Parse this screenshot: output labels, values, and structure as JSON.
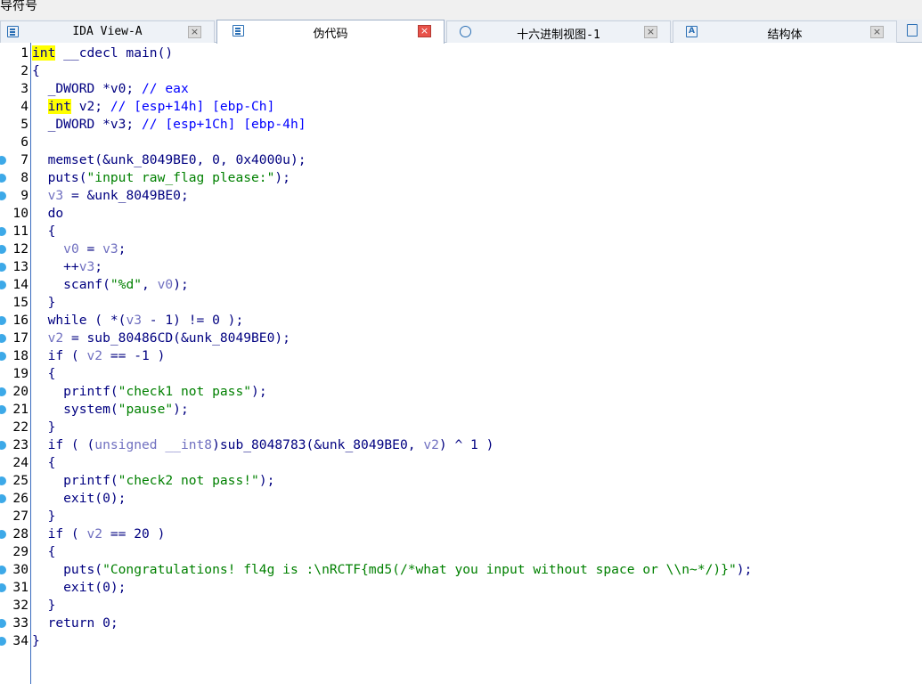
{
  "window": {
    "top_label": "导符号"
  },
  "tabs": [
    {
      "label": "IDA View-A",
      "icon": "ida-view-icon",
      "active": false
    },
    {
      "label": "伪代码",
      "icon": "pseudocode-icon",
      "active": true
    },
    {
      "label": "十六进制视图-1",
      "icon": "hex-view-icon",
      "active": false
    },
    {
      "label": "结构体",
      "icon": "structures-icon",
      "active": false
    }
  ],
  "close_glyph": "×",
  "colors": {
    "keyword_highlight": "#ffff00",
    "code": "#000080",
    "comment": "#0000ff",
    "string": "#008000",
    "variable": "#7070c0",
    "breakpoint": "#3da9e8"
  },
  "code_lines": [
    {
      "n": "1",
      "bp": false,
      "tokens": [
        [
          "int",
          "hl"
        ],
        [
          " __cdecl main()",
          "n"
        ]
      ]
    },
    {
      "n": "2",
      "bp": false,
      "tokens": [
        [
          "{",
          "n"
        ]
      ]
    },
    {
      "n": "3",
      "bp": false,
      "tokens": [
        [
          "  _DWORD *v0; ",
          "n"
        ],
        [
          "// eax",
          "c"
        ]
      ]
    },
    {
      "n": "4",
      "bp": false,
      "tokens": [
        [
          "  ",
          "n"
        ],
        [
          "int",
          "hl"
        ],
        [
          " v2; ",
          "n"
        ],
        [
          "// [esp+14h] [ebp-Ch]",
          "c"
        ]
      ]
    },
    {
      "n": "5",
      "bp": false,
      "tokens": [
        [
          "  _DWORD *v3; ",
          "n"
        ],
        [
          "// [esp+1Ch] [ebp-4h]",
          "c"
        ]
      ]
    },
    {
      "n": "6",
      "bp": false,
      "tokens": []
    },
    {
      "n": "7",
      "bp": true,
      "tokens": [
        [
          "  memset(&unk_8049BE0, 0, 0x4000u);",
          "n"
        ]
      ]
    },
    {
      "n": "8",
      "bp": true,
      "tokens": [
        [
          "  puts(",
          "n"
        ],
        [
          "\"input raw_flag please:\"",
          "s"
        ],
        [
          ");",
          "n"
        ]
      ]
    },
    {
      "n": "9",
      "bp": true,
      "tokens": [
        [
          "  ",
          "n"
        ],
        [
          "v3",
          "v"
        ],
        [
          " = &unk_8049BE0;",
          "n"
        ]
      ]
    },
    {
      "n": "10",
      "bp": false,
      "tokens": [
        [
          "  do",
          "n"
        ]
      ]
    },
    {
      "n": "11",
      "bp": true,
      "tokens": [
        [
          "  {",
          "n"
        ]
      ]
    },
    {
      "n": "12",
      "bp": true,
      "tokens": [
        [
          "    ",
          "n"
        ],
        [
          "v0",
          "v"
        ],
        [
          " = ",
          "n"
        ],
        [
          "v3",
          "v"
        ],
        [
          ";",
          "n"
        ]
      ]
    },
    {
      "n": "13",
      "bp": true,
      "tokens": [
        [
          "    ++",
          "n"
        ],
        [
          "v3",
          "v"
        ],
        [
          ";",
          "n"
        ]
      ]
    },
    {
      "n": "14",
      "bp": true,
      "tokens": [
        [
          "    scanf(",
          "n"
        ],
        [
          "\"%d\"",
          "s"
        ],
        [
          ", ",
          "n"
        ],
        [
          "v0",
          "v"
        ],
        [
          ");",
          "n"
        ]
      ]
    },
    {
      "n": "15",
      "bp": false,
      "tokens": [
        [
          "  }",
          "n"
        ]
      ]
    },
    {
      "n": "16",
      "bp": true,
      "tokens": [
        [
          "  while ( *(",
          "n"
        ],
        [
          "v3",
          "v"
        ],
        [
          " - 1) != 0 );",
          "n"
        ]
      ]
    },
    {
      "n": "17",
      "bp": true,
      "tokens": [
        [
          "  ",
          "n"
        ],
        [
          "v2",
          "v"
        ],
        [
          " = sub_80486CD(&unk_8049BE0);",
          "n"
        ]
      ]
    },
    {
      "n": "18",
      "bp": true,
      "tokens": [
        [
          "  if ( ",
          "n"
        ],
        [
          "v2",
          "v"
        ],
        [
          " == -1 )",
          "n"
        ]
      ]
    },
    {
      "n": "19",
      "bp": false,
      "tokens": [
        [
          "  {",
          "n"
        ]
      ]
    },
    {
      "n": "20",
      "bp": true,
      "tokens": [
        [
          "    printf(",
          "n"
        ],
        [
          "\"check1 not pass\"",
          "s"
        ],
        [
          ");",
          "n"
        ]
      ]
    },
    {
      "n": "21",
      "bp": true,
      "tokens": [
        [
          "    system(",
          "n"
        ],
        [
          "\"pause\"",
          "s"
        ],
        [
          ");",
          "n"
        ]
      ]
    },
    {
      "n": "22",
      "bp": false,
      "tokens": [
        [
          "  }",
          "n"
        ]
      ]
    },
    {
      "n": "23",
      "bp": true,
      "tokens": [
        [
          "  if ( (",
          "n"
        ],
        [
          "unsigned __int8",
          "v"
        ],
        [
          ")sub_8048783(&unk_8049BE0, ",
          "n"
        ],
        [
          "v2",
          "v"
        ],
        [
          ") ^ 1 )",
          "n"
        ]
      ]
    },
    {
      "n": "24",
      "bp": false,
      "tokens": [
        [
          "  {",
          "n"
        ]
      ]
    },
    {
      "n": "25",
      "bp": true,
      "tokens": [
        [
          "    printf(",
          "n"
        ],
        [
          "\"check2 not pass!\"",
          "s"
        ],
        [
          ");",
          "n"
        ]
      ]
    },
    {
      "n": "26",
      "bp": true,
      "tokens": [
        [
          "    exit(0);",
          "n"
        ]
      ]
    },
    {
      "n": "27",
      "bp": false,
      "tokens": [
        [
          "  }",
          "n"
        ]
      ]
    },
    {
      "n": "28",
      "bp": true,
      "tokens": [
        [
          "  if ( ",
          "n"
        ],
        [
          "v2",
          "v"
        ],
        [
          " == 20 )",
          "n"
        ]
      ]
    },
    {
      "n": "29",
      "bp": false,
      "tokens": [
        [
          "  {",
          "n"
        ]
      ]
    },
    {
      "n": "30",
      "bp": true,
      "tokens": [
        [
          "    puts(",
          "n"
        ],
        [
          "\"Congratulations! fl4g is :\\nRCTF{md5(/*what you input without space or \\\\n~*/)}\"",
          "s"
        ],
        [
          ");",
          "n"
        ]
      ]
    },
    {
      "n": "31",
      "bp": true,
      "tokens": [
        [
          "    exit(0);",
          "n"
        ]
      ]
    },
    {
      "n": "32",
      "bp": false,
      "tokens": [
        [
          "  }",
          "n"
        ]
      ]
    },
    {
      "n": "33",
      "bp": true,
      "tokens": [
        [
          "  return 0;",
          "n"
        ]
      ]
    },
    {
      "n": "34",
      "bp": true,
      "tokens": [
        [
          "}",
          "n"
        ]
      ]
    }
  ]
}
